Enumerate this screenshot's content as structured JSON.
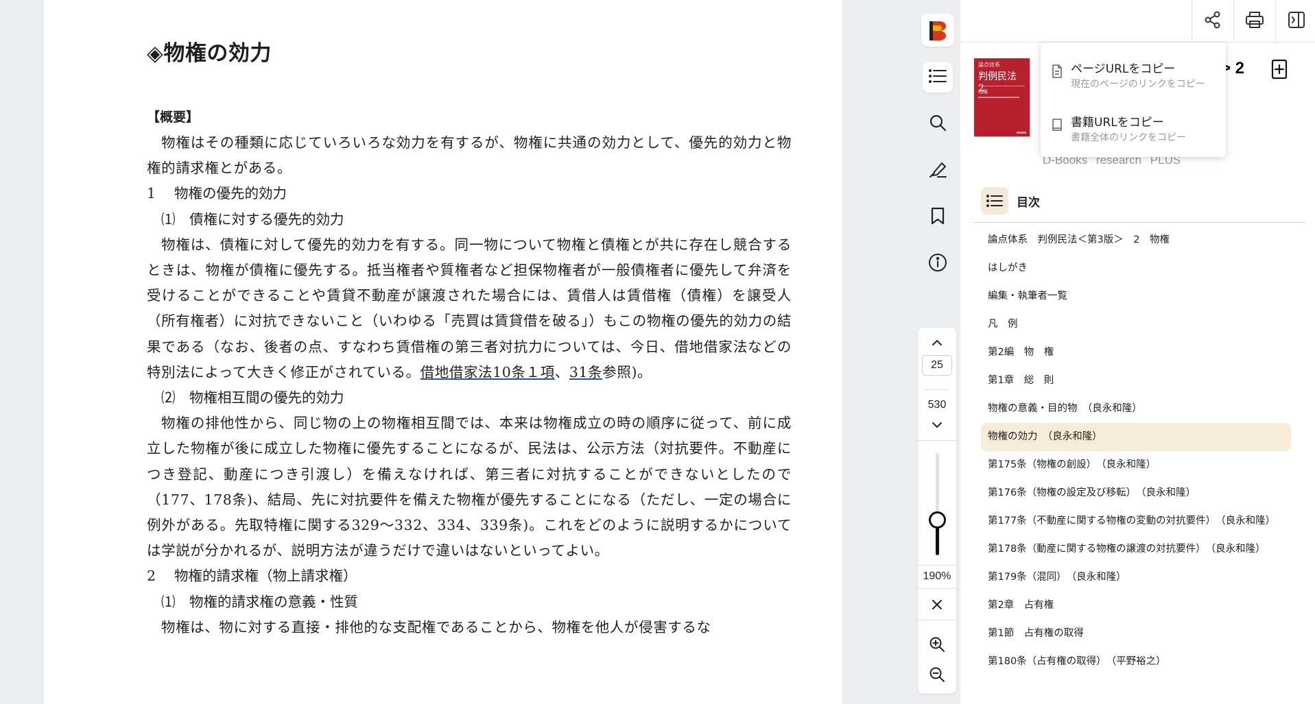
{
  "document": {
    "title": "◈物権の効力",
    "section_overview": "【概要】",
    "paragraph_1": "物権はその種類に応じていろいろな効力を有するが、物権に共通の効力として、優先的効力と物権的請求権とがある。",
    "heading_1": "1　 物権の優先的効力",
    "heading_1_1": "⑴　債権に対する優先的効力",
    "paragraph_2_text": "物権は、債権に対して優先的効力を有する。同一物について物権と債権とが共に存在し競合するときは、物権が債権に優先する。抵当権者や質権者など担保物権者が一般債権者に優先して弁済を受けることができることや賃貸不動産が譲渡された場合には、賃借人は賃借権（債権）を譲受人（所有権者）に対抗できないこと（いわゆる「売買は賃貸借を破る」）もこの物権の優先的効力の結果である（なお、後者の点、すなわち賃借権の第三者対抗力については、今日、借地借家法などの特別法によって大きく修正がされている。",
    "paragraph_2_link1": "借地借家法10条１項",
    "paragraph_2_sep": "、",
    "paragraph_2_link2": "31条",
    "paragraph_2_end": "参照)。",
    "heading_1_2": "⑵　物権相互間の優先的効力",
    "paragraph_3": "物権の排他性から、同じ物の上の物権相互間では、本来は物権成立の時の順序に従って、前に成立した物権が後に成立した物権に優先することになるが、民法は、公示方法（対抗要件。不動産につき登記、動産につき引渡し）を備えなければ、第三者に対抗することができないとしたので（177、178条)、結局、先に対抗要件を備えた物権が優先することになる（ただし、一定の場合に例外がある。先取特権に関する329〜332、334、339条)。これをどのように説明するかについては学説が分かれるが、説明方法が違うだけで違いはないといってよい。",
    "heading_2": "2　 物権的請求権（物上請求権）",
    "heading_2_1": "⑴　物権的請求権の意義・性質",
    "paragraph_4": "物権は、物に対する直接・排他的な支配権であることから、物権を他人が侵害するな"
  },
  "navigation": {
    "current_page": "25",
    "total_pages": "530",
    "zoom_level": "190%",
    "zoom_fraction": 0.28
  },
  "book": {
    "cover_series": "論点体系",
    "cover_title": "判例民法　2",
    "cover_sub": "物権",
    "volume_text": "> 2",
    "publisher": "D-Books research PLUS"
  },
  "share_menu": {
    "items": [
      {
        "title": "ページURLをコピー",
        "subtitle": "現在のページのリンクをコピー"
      },
      {
        "title": "書籍URLをコピー",
        "subtitle": "書籍全体のリンクをコピー"
      }
    ]
  },
  "toc": {
    "title": "目次",
    "items": [
      "論点体系　判例民法＜第3版＞　2　物権",
      "はしがき",
      "編集・執筆者一覧",
      "凡　例",
      "第2編　物　権",
      "第1章　総　則",
      "物権の意義・目的物　（良永和隆）",
      "物権の効力　（良永和隆）",
      "第175条（物権の創設）　（良永和隆）",
      "第176条（物権の設定及び移転）　（良永和隆）",
      "第177条（不動産に関する物権の変動の対抗要件）　（良永和隆）",
      "第178条（動産に関する物権の譲渡の対抗要件）　（良永和隆）",
      "第179条（混同）　（良永和隆）",
      "第2章　占有権",
      "第1節　占有権の取得",
      "第180条（占有権の取得）　（平野裕之）"
    ],
    "active_index": 7
  },
  "colors": {
    "accent": "#f6ecd8",
    "cover": "#b5202c"
  },
  "icons": [
    "logo-icon",
    "toc-icon",
    "search-icon",
    "highlight-icon",
    "bookmark-icon",
    "info-icon",
    "chevron-up-icon",
    "chevron-down-icon",
    "close-icon",
    "zoom-in-icon",
    "zoom-out-icon",
    "share-icon",
    "print-icon",
    "panel-icon",
    "add-icon",
    "page-icon",
    "book-icon"
  ]
}
